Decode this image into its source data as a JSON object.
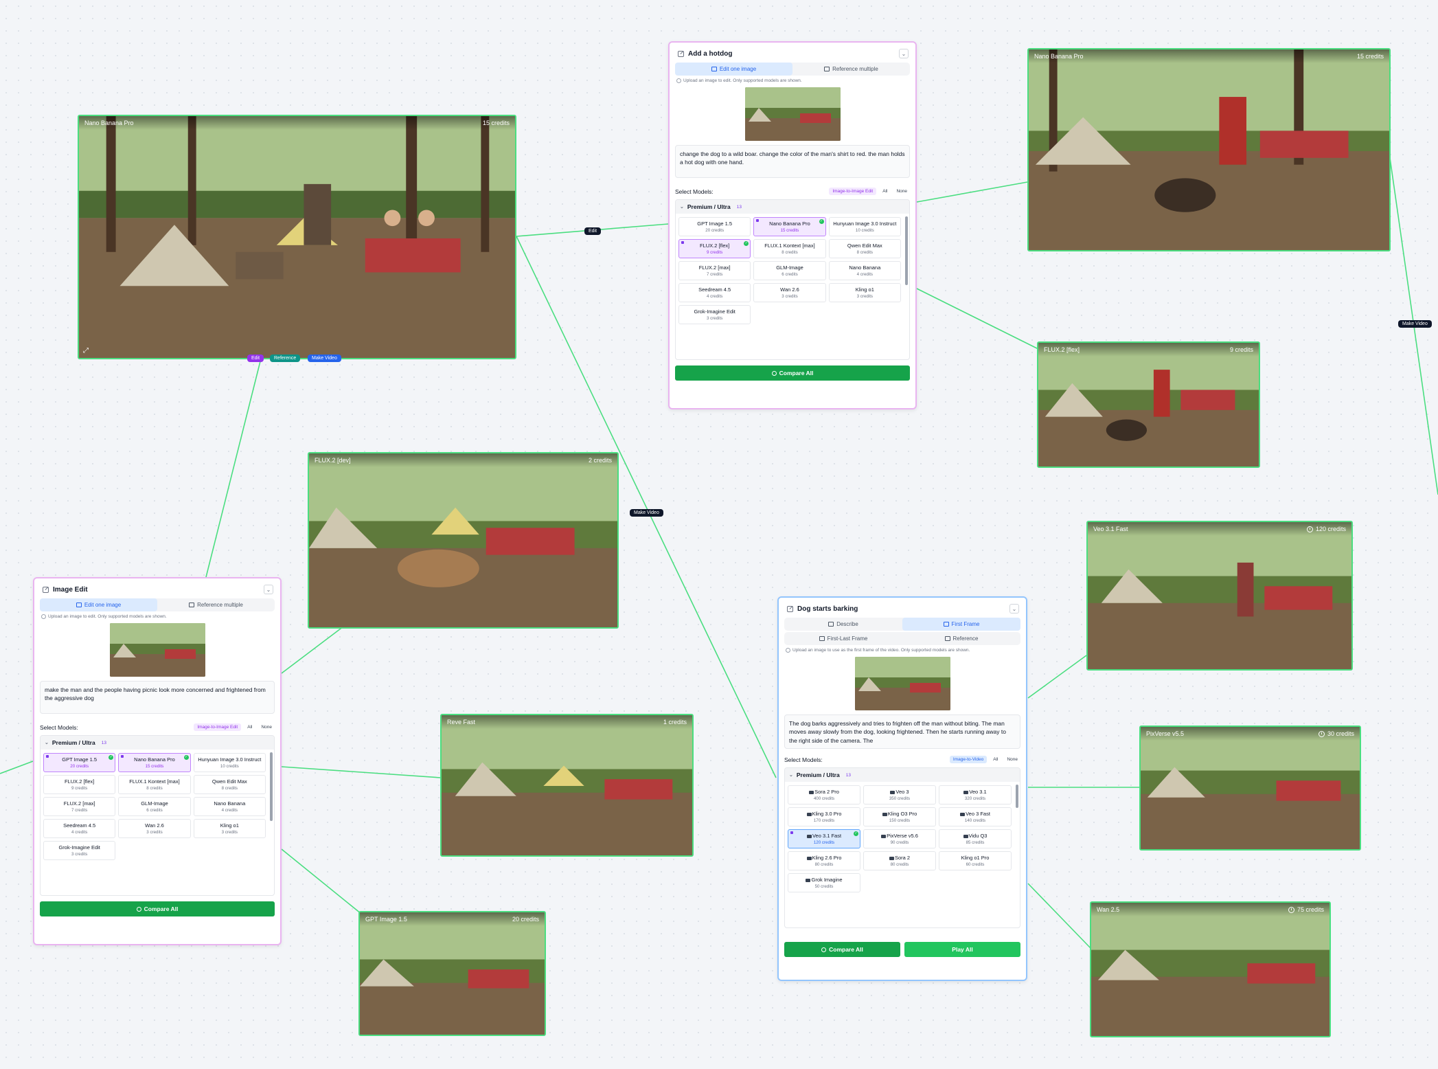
{
  "image_nodes": [
    {
      "model": "Nano Banana Pro",
      "credits": "15 credits"
    },
    {
      "model": "Nano Banana Pro",
      "credits": "15 credits"
    },
    {
      "model": "FLUX.2 [flex]",
      "credits": "9 credits"
    },
    {
      "model": "FLUX.2 [dev]",
      "credits": "2 credits"
    },
    {
      "model": "Veo 3.1 Fast",
      "credits": "120 credits"
    },
    {
      "model": "Reve Fast",
      "credits": "1 credits"
    },
    {
      "model": "PixVerse v5.5",
      "credits": "30 credits"
    },
    {
      "model": "GPT Image 1.5",
      "credits": "20 credits"
    },
    {
      "model": "Wan 2.5",
      "credits": "75 credits"
    }
  ],
  "edge_labels": {
    "edit": "Edit",
    "make_video_1": "Make Video",
    "make_video_2": "Make Video"
  },
  "node_actions": {
    "edit": "Edit",
    "reference": "Reference",
    "make_video": "Make Video"
  },
  "hotdog_panel": {
    "title": "Add a hotdog",
    "tab_edit": "Edit one image",
    "tab_ref": "Reference multiple",
    "hint": "Upload an image to edit. Only supported models are shown.",
    "prompt": "change the dog to a wild boar. change the color of the man's shirt to red. the man holds a hot dog with one hand.",
    "select_label": "Select Models:",
    "mode": "Image-to-Image Edit",
    "all": "All",
    "none": "None",
    "group": "Premium / Ultra",
    "group_count": "13",
    "models": [
      {
        "name": "GPT Image 1.5",
        "credits": "20 credits"
      },
      {
        "name": "Nano Banana Pro",
        "credits": "15 credits"
      },
      {
        "name": "Hunyuan Image 3.0 Instruct",
        "credits": "10 credits"
      },
      {
        "name": "FLUX.2 [flex]",
        "credits": "9 credits"
      },
      {
        "name": "FLUX.1 Kontext [max]",
        "credits": "8 credits"
      },
      {
        "name": "Qwen Edit Max",
        "credits": "8 credits"
      },
      {
        "name": "FLUX.2 [max]",
        "credits": "7 credits"
      },
      {
        "name": "GLM-Image",
        "credits": "6 credits"
      },
      {
        "name": "Nano Banana",
        "credits": "4 credits"
      },
      {
        "name": "Seedream 4.5",
        "credits": "4 credits"
      },
      {
        "name": "Wan 2.6",
        "credits": "3 credits"
      },
      {
        "name": "Kling o1",
        "credits": "3 credits"
      },
      {
        "name": "Grok-Imagine Edit",
        "credits": "3 credits"
      }
    ],
    "compare": "Compare All"
  },
  "edit_panel": {
    "title": "Image Edit",
    "tab_edit": "Edit one image",
    "tab_ref": "Reference multiple",
    "hint": "Upload an image to edit. Only supported models are shown.",
    "prompt": "make the man and the people having picnic look more concerned and frightened from the aggressive dog",
    "select_label": "Select Models:",
    "mode": "Image-to-Image Edit",
    "all": "All",
    "none": "None",
    "group": "Premium / Ultra",
    "group_count": "13",
    "models": [
      {
        "name": "GPT Image 1.5",
        "credits": "20 credits"
      },
      {
        "name": "Nano Banana Pro",
        "credits": "15 credits"
      },
      {
        "name": "Hunyuan Image 3.0 Instruct",
        "credits": "10 credits"
      },
      {
        "name": "FLUX.2 [flex]",
        "credits": "9 credits"
      },
      {
        "name": "FLUX.1 Kontext [max]",
        "credits": "8 credits"
      },
      {
        "name": "Qwen Edit Max",
        "credits": "8 credits"
      },
      {
        "name": "FLUX.2 [max]",
        "credits": "7 credits"
      },
      {
        "name": "GLM-Image",
        "credits": "6 credits"
      },
      {
        "name": "Nano Banana",
        "credits": "4 credits"
      },
      {
        "name": "Seedream 4.5",
        "credits": "4 credits"
      },
      {
        "name": "Wan 2.6",
        "credits": "3 credits"
      },
      {
        "name": "Kling o1",
        "credits": "3 credits"
      },
      {
        "name": "Grok-Imagine Edit",
        "credits": "3 credits"
      }
    ],
    "compare": "Compare All"
  },
  "video_panel": {
    "title": "Dog starts barking",
    "tab_describe": "Describe",
    "tab_first": "First Frame",
    "tab_first_last": "First-Last Frame",
    "tab_reference": "Reference",
    "hint": "Upload an image to use as the first frame of the video. Only supported models are shown.",
    "prompt": "The dog barks aggressively and tries to frighten off the man without biting. The man moves away slowly from the dog, looking frightened. Then he starts running away to the right side of the camera. The",
    "select_label": "Select Models:",
    "mode": "Image-to-Video",
    "all": "All",
    "none": "None",
    "group": "Premium / Ultra",
    "group_count": "13",
    "models": [
      {
        "name": "Sora 2 Pro",
        "credits": "400 credits"
      },
      {
        "name": "Veo 3",
        "credits": "350 credits"
      },
      {
        "name": "Veo 3.1",
        "credits": "320 credits"
      },
      {
        "name": "Kling 3.0 Pro",
        "credits": "170 credits"
      },
      {
        "name": "Kling O3 Pro",
        "credits": "150 credits"
      },
      {
        "name": "Veo 3 Fast",
        "credits": "140 credits"
      },
      {
        "name": "Veo 3.1 Fast",
        "credits": "120 credits"
      },
      {
        "name": "PixVerse v5.6",
        "credits": "90 credits"
      },
      {
        "name": "Vidu Q3",
        "credits": "85 credits"
      },
      {
        "name": "Kling 2.6 Pro",
        "credits": "80 credits"
      },
      {
        "name": "Sora 2",
        "credits": "80 credits"
      },
      {
        "name": "Kling o1 Pro",
        "credits": "60 credits"
      },
      {
        "name": "Grok Imagine",
        "credits": "50 credits"
      }
    ],
    "compare": "Compare All",
    "play": "Play All"
  }
}
